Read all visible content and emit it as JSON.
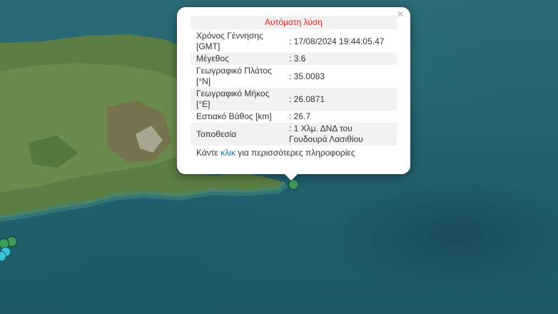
{
  "popup": {
    "title": "Αυτόματη λύση",
    "close_symbol": "×",
    "rows": [
      {
        "label": "Χρόνος Γέννησης [GMT]",
        "value": ": 17/08/2024 19:44:05.47"
      },
      {
        "label": "Μέγεθος",
        "value": ": 3.6"
      },
      {
        "label": "Γεωγραφικό Πλάτος [°N]",
        "value": ": 35.0083"
      },
      {
        "label": "Γεωγραφικό Μήκος [°E]",
        "value": ": 26.0871"
      },
      {
        "label": "Εστιακό Βάθος [km]",
        "value": ": 26.7"
      },
      {
        "label": "Τοποθεσία",
        "value": ": 1 Χλμ. ΔΝΔ του Γουδουρά Λασιθίου"
      }
    ],
    "footer": {
      "before": "Κάντε ",
      "link": "κλικ",
      "after": " για περισσότερες πληροφορίες"
    }
  },
  "map": {
    "icons": {
      "close": "close-icon",
      "marker": "earthquake-marker-icon"
    },
    "colors": {
      "marker_green": "#3c9a5a",
      "marker_cyan": "#35c4d8",
      "title_red": "#e0241c",
      "link_blue": "#1d6fb0"
    }
  }
}
